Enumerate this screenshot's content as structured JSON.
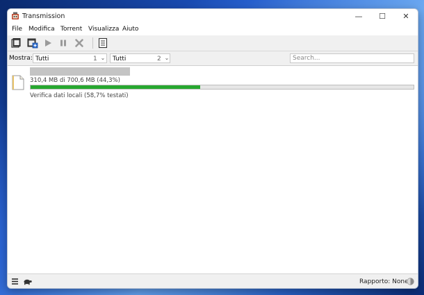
{
  "window": {
    "title": "Transmission",
    "minimize": "—",
    "maximize": "☐",
    "close": "✕"
  },
  "menu": {
    "items": [
      "File",
      "Modifica",
      "Torrent",
      "Visualizza",
      "Aiuto"
    ]
  },
  "toolbar": {
    "icons": [
      "open-torrent-icon",
      "open-url-icon",
      "start-icon",
      "pause-icon",
      "remove-icon",
      "properties-icon"
    ]
  },
  "filter": {
    "label": "Mostra:",
    "activity": {
      "value": "Tutti",
      "count": "1"
    },
    "tracker": {
      "value": "Tutti",
      "count": "2"
    },
    "search_placeholder": "Search..."
  },
  "torrents": [
    {
      "progress_text": "310,4 MB di 700,6 MB (44,3%)",
      "progress_fraction": 0.443,
      "status": "Verifica dati locali (58,7% testati)",
      "color": "#27a82f"
    }
  ],
  "statusbar": {
    "ratio": "Rapporto: None"
  }
}
